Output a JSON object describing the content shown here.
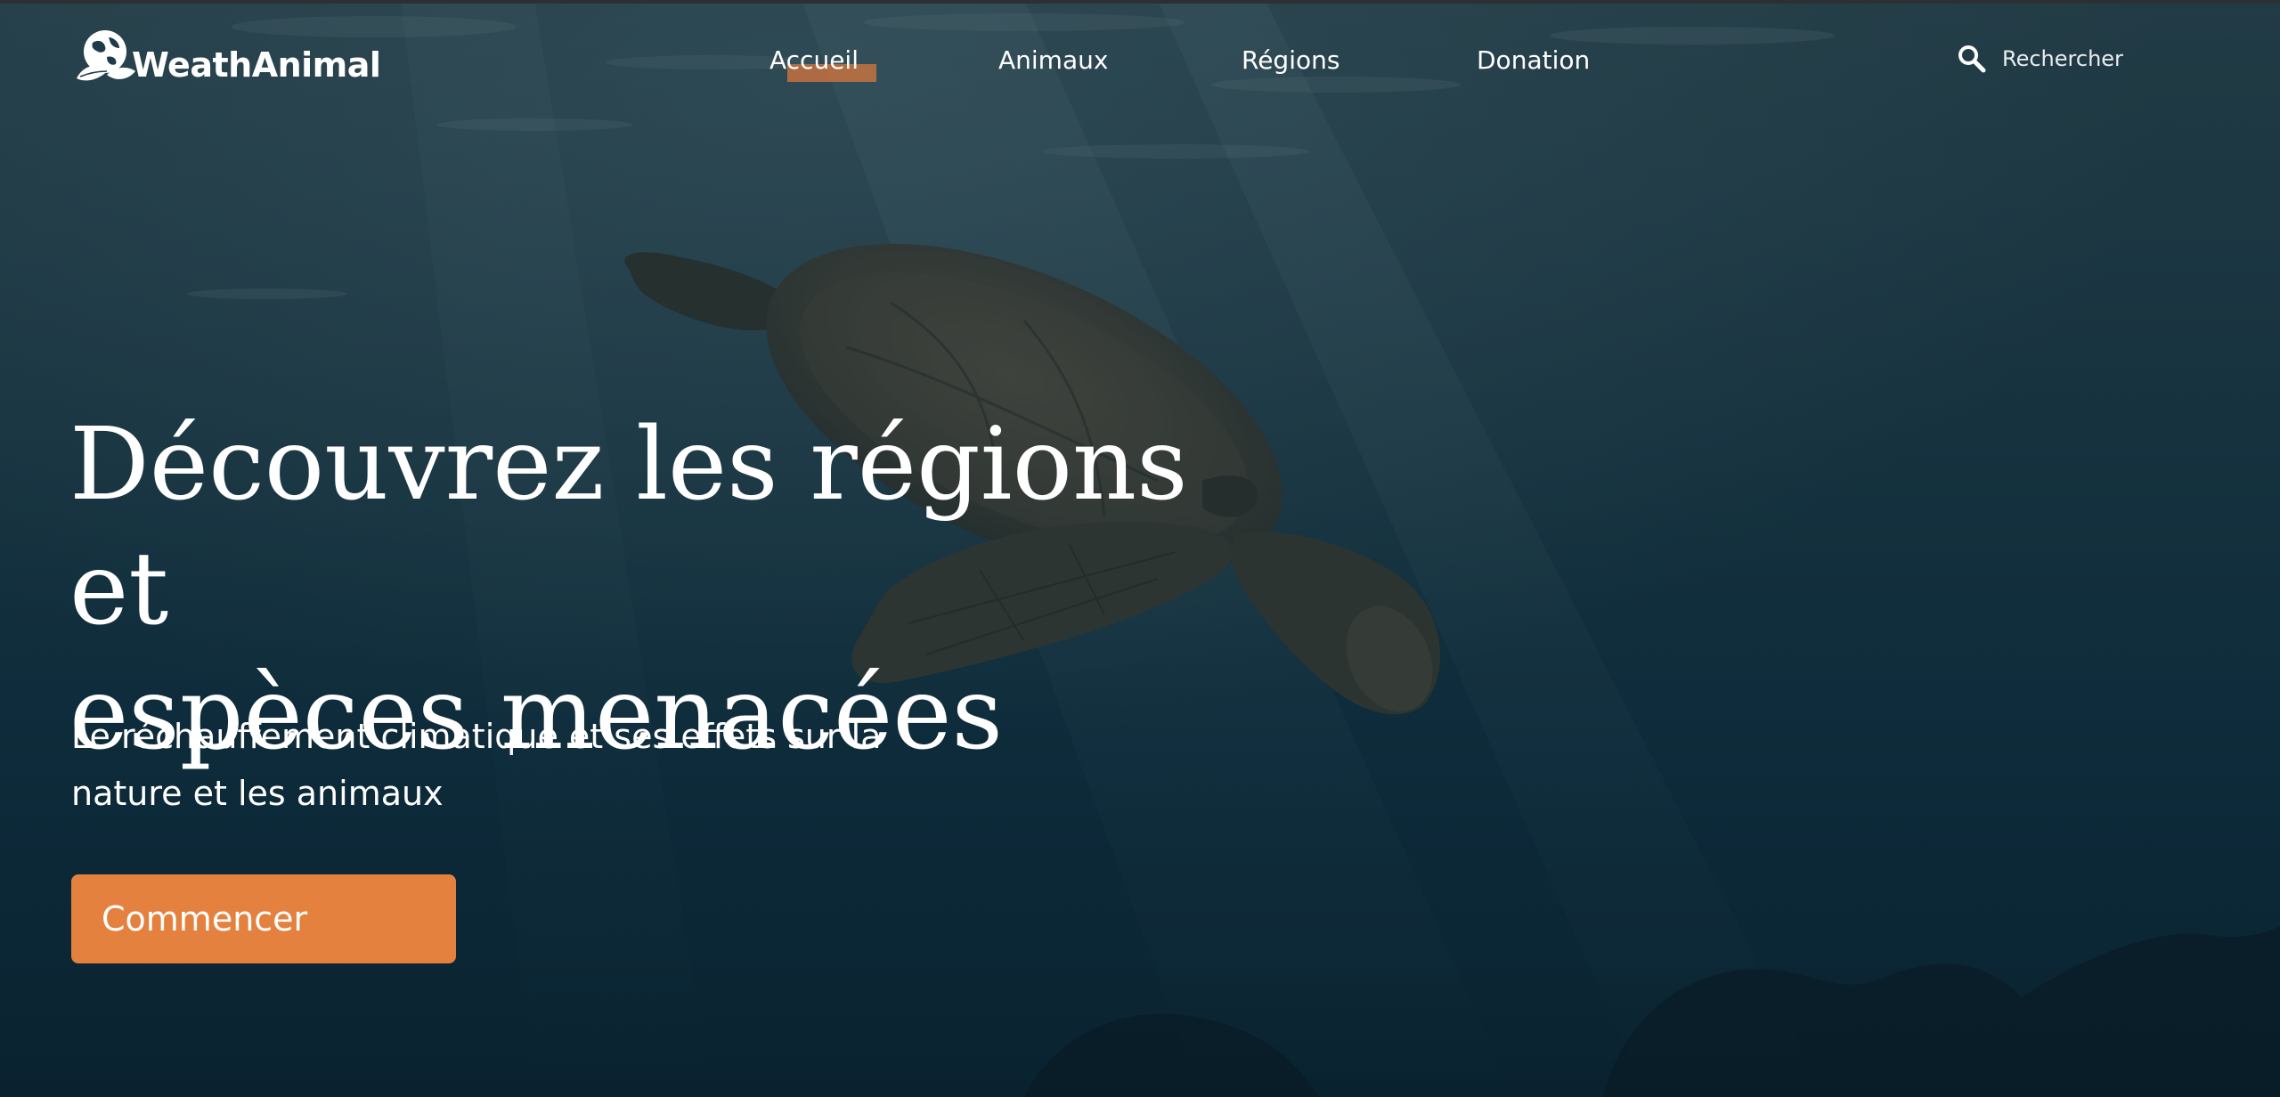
{
  "brand": {
    "name": "WeathAnimal",
    "logo_icon": "globe-leaf-icon"
  },
  "nav": {
    "items": [
      {
        "label": "Accueil",
        "active": true
      },
      {
        "label": "Animaux",
        "active": false
      },
      {
        "label": "Régions",
        "active": false
      },
      {
        "label": "Donation",
        "active": false
      }
    ]
  },
  "search": {
    "icon": "search-icon",
    "label": "Rechercher"
  },
  "hero": {
    "title_line1": "Découvrez les régions et",
    "title_line2": "espèces menacées",
    "subtitle_line1": "Le réchauffement climatique et ses effets sur la",
    "subtitle_line2": "nature et les animaux",
    "cta_label": "Commencer",
    "background_image": "sea-turtle-underwater"
  },
  "colors": {
    "accent": "#e5813f",
    "background": "#0d2a38",
    "text": "#ffffff"
  }
}
